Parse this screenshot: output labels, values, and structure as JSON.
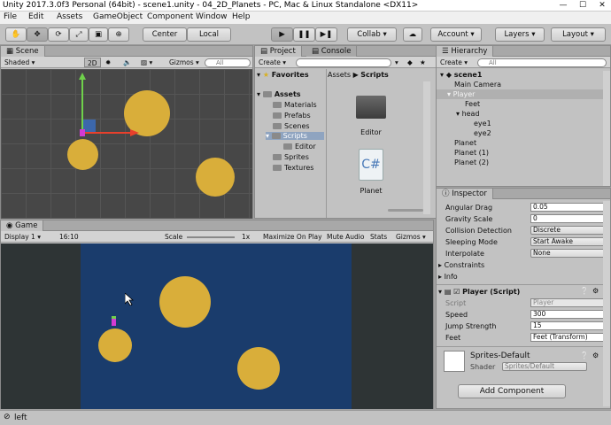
{
  "window": {
    "title": "Unity 2017.3.0f3 Personal (64bit) - scene1.unity - 04_2D_Planets - PC, Mac & Linux Standalone <DX11>",
    "minimize": "—",
    "maximize": "☐",
    "close": "✕"
  },
  "menu": [
    "File",
    "Edit",
    "Assets",
    "GameObject",
    "Component",
    "Window",
    "Help"
  ],
  "toolbar": {
    "center": "Center",
    "local": "Local",
    "collab": "Collab ▾",
    "account": "Account ▾",
    "layers": "Layers ▾",
    "layout": "Layout ▾"
  },
  "scene": {
    "tab": "Scene",
    "shaded": "Shaded",
    "mode2d": "2D",
    "gizmos": "Gizmos ▾",
    "search": "All"
  },
  "project": {
    "tab": "Project",
    "tab2": "Console",
    "create": "Create ▾",
    "favorites": "Favorites",
    "assets": "Assets",
    "folders": [
      "Materials",
      "Prefabs",
      "Scenes",
      "Scripts",
      "Editor",
      "Sprites",
      "Textures"
    ],
    "breadcrumb_root": "Assets",
    "breadcrumb_sep": "▶",
    "breadcrumb_current": "Scripts",
    "items": [
      "Editor",
      "Planet"
    ]
  },
  "hierarchy": {
    "tab": "Hierarchy",
    "create": "Create ▾",
    "search": "All",
    "rows": [
      "scene1",
      "Main Camera",
      "Player",
      "Feet",
      "head",
      "eye1",
      "eye2",
      "Planet",
      "Planet (1)",
      "Planet (2)"
    ]
  },
  "inspector": {
    "tab": "Inspector",
    "rb_fields": [
      {
        "label": "Angular Drag",
        "value": "0.05"
      },
      {
        "label": "Gravity Scale",
        "value": "0"
      },
      {
        "label": "Collision Detection",
        "value": "Discrete"
      },
      {
        "label": "Sleeping Mode",
        "value": "Start Awake"
      },
      {
        "label": "Interpolate",
        "value": "None"
      }
    ],
    "constraints": "Constraints",
    "info": "Info",
    "component_title": "Player (Script)",
    "script_fields": [
      {
        "label": "Script",
        "value": "Player"
      },
      {
        "label": "Speed",
        "value": "300"
      },
      {
        "label": "Jump Strength",
        "value": "15"
      },
      {
        "label": "Feet",
        "value": "Feet (Transform)"
      }
    ],
    "material": "Sprites-Default",
    "shader_label": "Shader",
    "shader_value": "Sprites/Default",
    "add_component": "Add Component"
  },
  "game": {
    "tab": "Game",
    "display": "Display 1",
    "aspect": "16:10",
    "scale_label": "Scale",
    "scale_value": "1x",
    "maximize": "Maximize On Play",
    "mute": "Mute Audio",
    "stats": "Stats",
    "gizmos": "Gizmos ▾"
  },
  "status": {
    "text": "left"
  },
  "colors": {
    "planet": "#d9ae3a",
    "game_bg": "#1a3c6c",
    "scene_bg": "#474747"
  }
}
